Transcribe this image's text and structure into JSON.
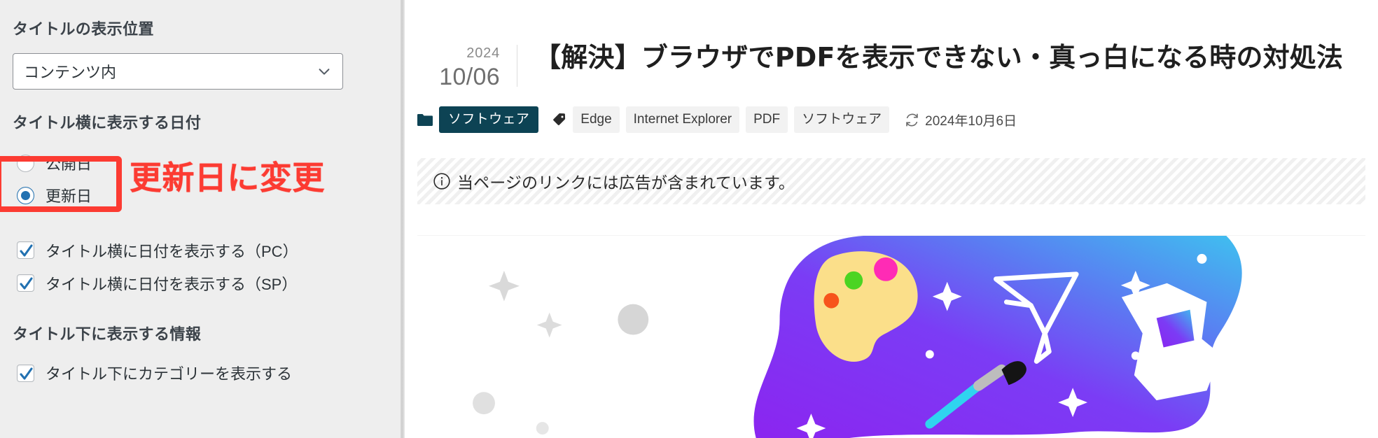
{
  "sidebar": {
    "sections": [
      {
        "heading": "タイトルの表示位置"
      },
      {
        "heading": "タイトル横に表示する日付"
      },
      {
        "heading": "タイトル下に表示する情報"
      }
    ],
    "title_position_select": {
      "label": "タイトルの表示位置",
      "value": "コンテンツ内",
      "chevron_icon": "chevron-down-icon"
    },
    "date_heading": "タイトル横に表示する日付",
    "radios": [
      {
        "label": "公開日",
        "checked": false
      },
      {
        "label": "更新日",
        "checked": true
      }
    ],
    "checkboxes": [
      {
        "label": "タイトル横に日付を表示する（PC）",
        "checked": true
      },
      {
        "label": "タイトル横に日付を表示する（SP）",
        "checked": true
      }
    ],
    "below_title_heading": "タイトル下に表示する情報",
    "below_title_checkboxes": [
      {
        "label": "タイトル下にカテゴリーを表示する",
        "checked": true
      }
    ],
    "annotation": {
      "text": "更新日に変更",
      "color": "#fc3b32"
    }
  },
  "content": {
    "article": {
      "date_year": "2024",
      "date_monthday": "10/06",
      "title": "【解決】ブラウザでPDFを表示できない・真っ白になる時の対処法",
      "category_icon": "folder-icon",
      "category": "ソフトウェア",
      "tag_icon": "tag-icon",
      "tags": [
        "Edge",
        "Internet Explorer",
        "PDF",
        "ソフトウェア"
      ],
      "updated_icon": "refresh-icon",
      "updated_date": "2024年10月6日"
    },
    "ad_notice": {
      "icon": "info-circle-icon",
      "text": "当ページのリンクには広告が含まれています。"
    },
    "featured_image": {
      "alt": "design-tools-illustration",
      "gradient_start": "#8b25f0",
      "gradient_end": "#3fc0ef"
    }
  },
  "colors": {
    "sidebar_bg": "#eeeeee",
    "accent_blue": "#2271b1",
    "category_badge": "#0d4354",
    "annotation_red": "#fc3b32"
  }
}
